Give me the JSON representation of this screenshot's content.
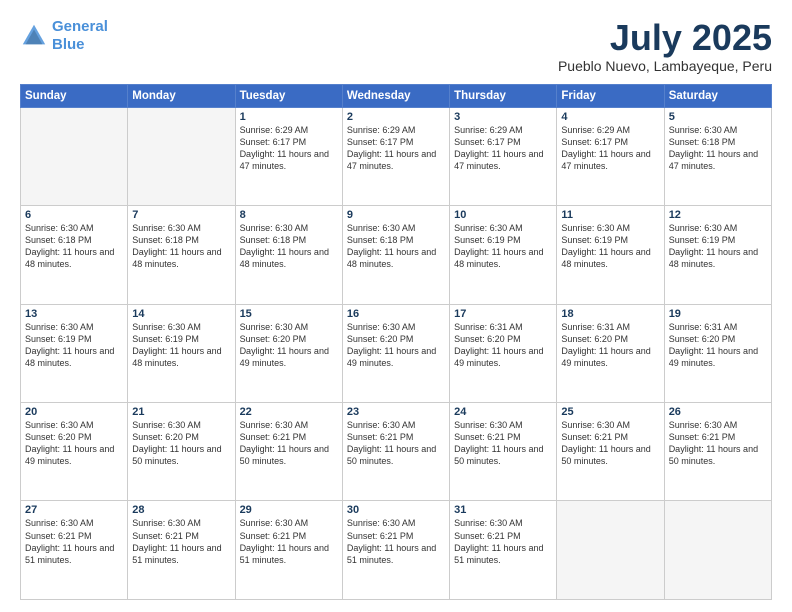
{
  "header": {
    "logo_line1": "General",
    "logo_line2": "Blue",
    "month": "July 2025",
    "location": "Pueblo Nuevo, Lambayeque, Peru"
  },
  "weekdays": [
    "Sunday",
    "Monday",
    "Tuesday",
    "Wednesday",
    "Thursday",
    "Friday",
    "Saturday"
  ],
  "weeks": [
    [
      {
        "day": "",
        "info": ""
      },
      {
        "day": "",
        "info": ""
      },
      {
        "day": "1",
        "info": "Sunrise: 6:29 AM\nSunset: 6:17 PM\nDaylight: 11 hours and 47 minutes."
      },
      {
        "day": "2",
        "info": "Sunrise: 6:29 AM\nSunset: 6:17 PM\nDaylight: 11 hours and 47 minutes."
      },
      {
        "day": "3",
        "info": "Sunrise: 6:29 AM\nSunset: 6:17 PM\nDaylight: 11 hours and 47 minutes."
      },
      {
        "day": "4",
        "info": "Sunrise: 6:29 AM\nSunset: 6:17 PM\nDaylight: 11 hours and 47 minutes."
      },
      {
        "day": "5",
        "info": "Sunrise: 6:30 AM\nSunset: 6:18 PM\nDaylight: 11 hours and 47 minutes."
      }
    ],
    [
      {
        "day": "6",
        "info": "Sunrise: 6:30 AM\nSunset: 6:18 PM\nDaylight: 11 hours and 48 minutes."
      },
      {
        "day": "7",
        "info": "Sunrise: 6:30 AM\nSunset: 6:18 PM\nDaylight: 11 hours and 48 minutes."
      },
      {
        "day": "8",
        "info": "Sunrise: 6:30 AM\nSunset: 6:18 PM\nDaylight: 11 hours and 48 minutes."
      },
      {
        "day": "9",
        "info": "Sunrise: 6:30 AM\nSunset: 6:18 PM\nDaylight: 11 hours and 48 minutes."
      },
      {
        "day": "10",
        "info": "Sunrise: 6:30 AM\nSunset: 6:19 PM\nDaylight: 11 hours and 48 minutes."
      },
      {
        "day": "11",
        "info": "Sunrise: 6:30 AM\nSunset: 6:19 PM\nDaylight: 11 hours and 48 minutes."
      },
      {
        "day": "12",
        "info": "Sunrise: 6:30 AM\nSunset: 6:19 PM\nDaylight: 11 hours and 48 minutes."
      }
    ],
    [
      {
        "day": "13",
        "info": "Sunrise: 6:30 AM\nSunset: 6:19 PM\nDaylight: 11 hours and 48 minutes."
      },
      {
        "day": "14",
        "info": "Sunrise: 6:30 AM\nSunset: 6:19 PM\nDaylight: 11 hours and 48 minutes."
      },
      {
        "day": "15",
        "info": "Sunrise: 6:30 AM\nSunset: 6:20 PM\nDaylight: 11 hours and 49 minutes."
      },
      {
        "day": "16",
        "info": "Sunrise: 6:30 AM\nSunset: 6:20 PM\nDaylight: 11 hours and 49 minutes."
      },
      {
        "day": "17",
        "info": "Sunrise: 6:31 AM\nSunset: 6:20 PM\nDaylight: 11 hours and 49 minutes."
      },
      {
        "day": "18",
        "info": "Sunrise: 6:31 AM\nSunset: 6:20 PM\nDaylight: 11 hours and 49 minutes."
      },
      {
        "day": "19",
        "info": "Sunrise: 6:31 AM\nSunset: 6:20 PM\nDaylight: 11 hours and 49 minutes."
      }
    ],
    [
      {
        "day": "20",
        "info": "Sunrise: 6:30 AM\nSunset: 6:20 PM\nDaylight: 11 hours and 49 minutes."
      },
      {
        "day": "21",
        "info": "Sunrise: 6:30 AM\nSunset: 6:20 PM\nDaylight: 11 hours and 50 minutes."
      },
      {
        "day": "22",
        "info": "Sunrise: 6:30 AM\nSunset: 6:21 PM\nDaylight: 11 hours and 50 minutes."
      },
      {
        "day": "23",
        "info": "Sunrise: 6:30 AM\nSunset: 6:21 PM\nDaylight: 11 hours and 50 minutes."
      },
      {
        "day": "24",
        "info": "Sunrise: 6:30 AM\nSunset: 6:21 PM\nDaylight: 11 hours and 50 minutes."
      },
      {
        "day": "25",
        "info": "Sunrise: 6:30 AM\nSunset: 6:21 PM\nDaylight: 11 hours and 50 minutes."
      },
      {
        "day": "26",
        "info": "Sunrise: 6:30 AM\nSunset: 6:21 PM\nDaylight: 11 hours and 50 minutes."
      }
    ],
    [
      {
        "day": "27",
        "info": "Sunrise: 6:30 AM\nSunset: 6:21 PM\nDaylight: 11 hours and 51 minutes."
      },
      {
        "day": "28",
        "info": "Sunrise: 6:30 AM\nSunset: 6:21 PM\nDaylight: 11 hours and 51 minutes."
      },
      {
        "day": "29",
        "info": "Sunrise: 6:30 AM\nSunset: 6:21 PM\nDaylight: 11 hours and 51 minutes."
      },
      {
        "day": "30",
        "info": "Sunrise: 6:30 AM\nSunset: 6:21 PM\nDaylight: 11 hours and 51 minutes."
      },
      {
        "day": "31",
        "info": "Sunrise: 6:30 AM\nSunset: 6:21 PM\nDaylight: 11 hours and 51 minutes."
      },
      {
        "day": "",
        "info": ""
      },
      {
        "day": "",
        "info": ""
      }
    ]
  ]
}
